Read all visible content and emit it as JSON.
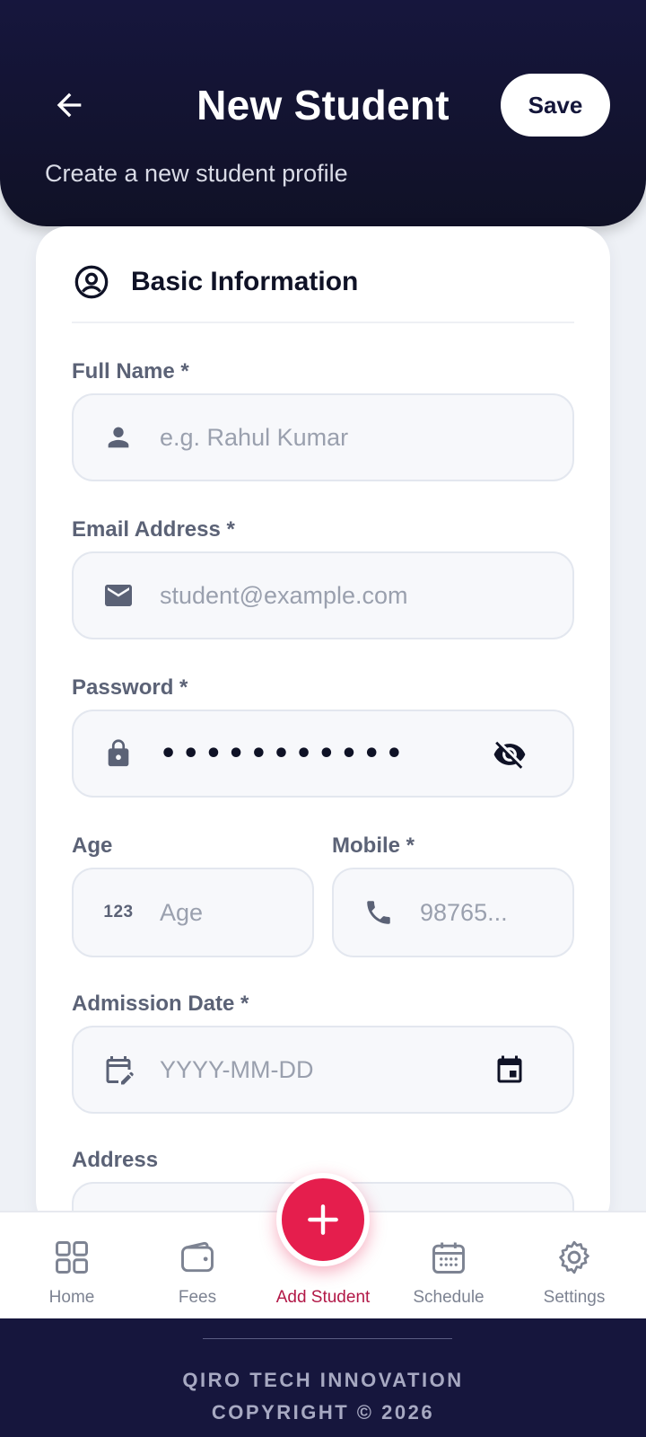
{
  "header": {
    "title": "New Student",
    "save_label": "Save",
    "subtitle": "Create a new student profile"
  },
  "section": {
    "title": "Basic Information",
    "icon": "account-circle-icon"
  },
  "form": {
    "full_name": {
      "label": "Full Name *",
      "placeholder": "e.g. Rahul Kumar",
      "icon": "person-icon"
    },
    "email": {
      "label": "Email Address *",
      "placeholder": "student@example.com",
      "icon": "mail-icon"
    },
    "password": {
      "label": "Password *",
      "masked_value": "•••••••••••",
      "icon": "lock-icon",
      "toggle_icon": "eye-off-icon"
    },
    "age": {
      "label": "Age",
      "placeholder": "Age",
      "icon_text": "123"
    },
    "mobile": {
      "label": "Mobile *",
      "placeholder": "98765...",
      "icon": "phone-icon"
    },
    "admission_date": {
      "label": "Admission Date *",
      "placeholder": "YYYY-MM-DD",
      "icon": "edit-calendar-icon",
      "picker_icon": "calendar-icon"
    },
    "address": {
      "label": "Address"
    }
  },
  "nav": {
    "items": [
      {
        "label": "Home",
        "icon": "grid-icon"
      },
      {
        "label": "Fees",
        "icon": "wallet-icon"
      },
      {
        "label": "Add Student",
        "icon": "plus-icon",
        "active": true
      },
      {
        "label": "Schedule",
        "icon": "calendar-icon"
      },
      {
        "label": "Settings",
        "icon": "gear-icon"
      }
    ]
  },
  "footer": {
    "line1": "QIRO TECH INNOVATION",
    "line2": "COPYRIGHT © 2026"
  },
  "colors": {
    "header_bg": "#16163d",
    "accent": "#e51e4d",
    "active_nav": "#b21847",
    "label": "#5b6276"
  }
}
